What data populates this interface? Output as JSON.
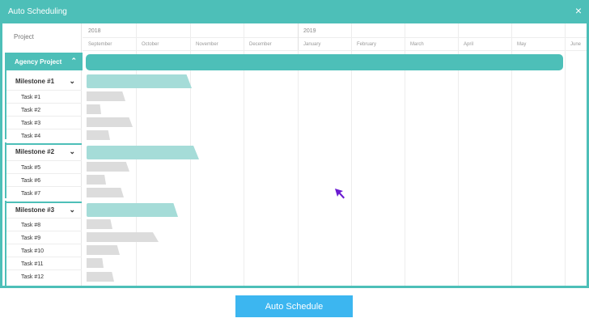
{
  "window": {
    "title": "Auto Scheduling",
    "close_symbol": "×"
  },
  "timeline": {
    "project_label": "Project",
    "years": [
      "2018",
      "2019"
    ],
    "months": [
      "September",
      "October",
      "November",
      "December",
      "January",
      "February",
      "March",
      "April",
      "May",
      "June"
    ]
  },
  "project": {
    "name": "Agency Project"
  },
  "milestones": [
    {
      "name": "Milestone #1",
      "tasks": [
        "Task #1",
        "Task #2",
        "Task #3",
        "Task #4"
      ]
    },
    {
      "name": "Milestone #2",
      "tasks": [
        "Task #5",
        "Task #6",
        "Task #7"
      ]
    },
    {
      "name": "Milestone #3",
      "tasks": [
        "Task #8",
        "Task #9",
        "Task #10",
        "Task #11",
        "Task #12"
      ]
    }
  ],
  "actions": {
    "auto_schedule_label": "Auto Schedule"
  },
  "colors": {
    "accent": "#4dbfb8",
    "milestone_bar": "#a5dcd8",
    "task_bar": "#dcdcdc",
    "button": "#3cb6f0",
    "cursor": "#6a1bd1"
  }
}
